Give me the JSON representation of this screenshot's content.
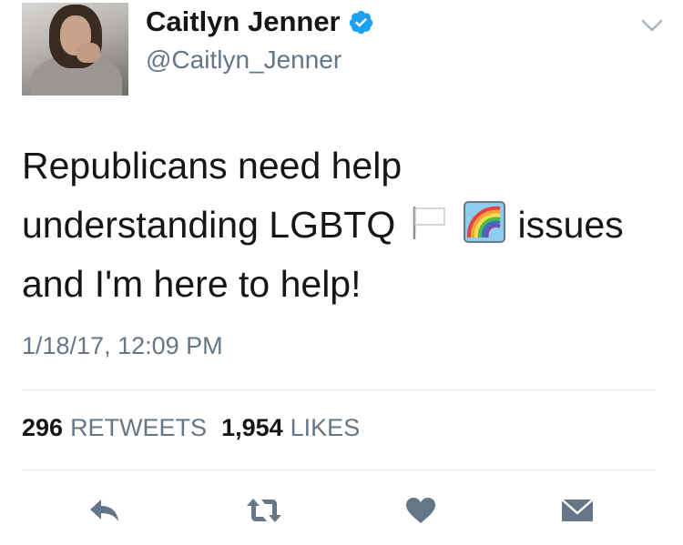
{
  "user": {
    "name": "Caitlyn Jenner",
    "handle": "@Caitlyn_Jenner",
    "verified": true
  },
  "tweet": {
    "line1": "Republicans need help",
    "line2_before": "understanding LGBTQ",
    "line2_after": "issues",
    "line3": "and I'm here to help!",
    "emojis": [
      "white-flag-icon",
      "rainbow-icon"
    ]
  },
  "timestamp": "1/18/17, 12:09 PM",
  "stats": {
    "retweets_count": "296",
    "retweets_label": "RETWEETS",
    "likes_count": "1,954",
    "likes_label": "LIKES"
  },
  "actions": [
    "reply-icon",
    "retweet-icon",
    "like-icon",
    "direct-message-icon"
  ],
  "colors": {
    "verified_blue": "#1da1f2",
    "text_primary": "#14171a",
    "text_secondary": "#657786",
    "divider": "#e1e8ed",
    "action_icon": "#657786"
  }
}
